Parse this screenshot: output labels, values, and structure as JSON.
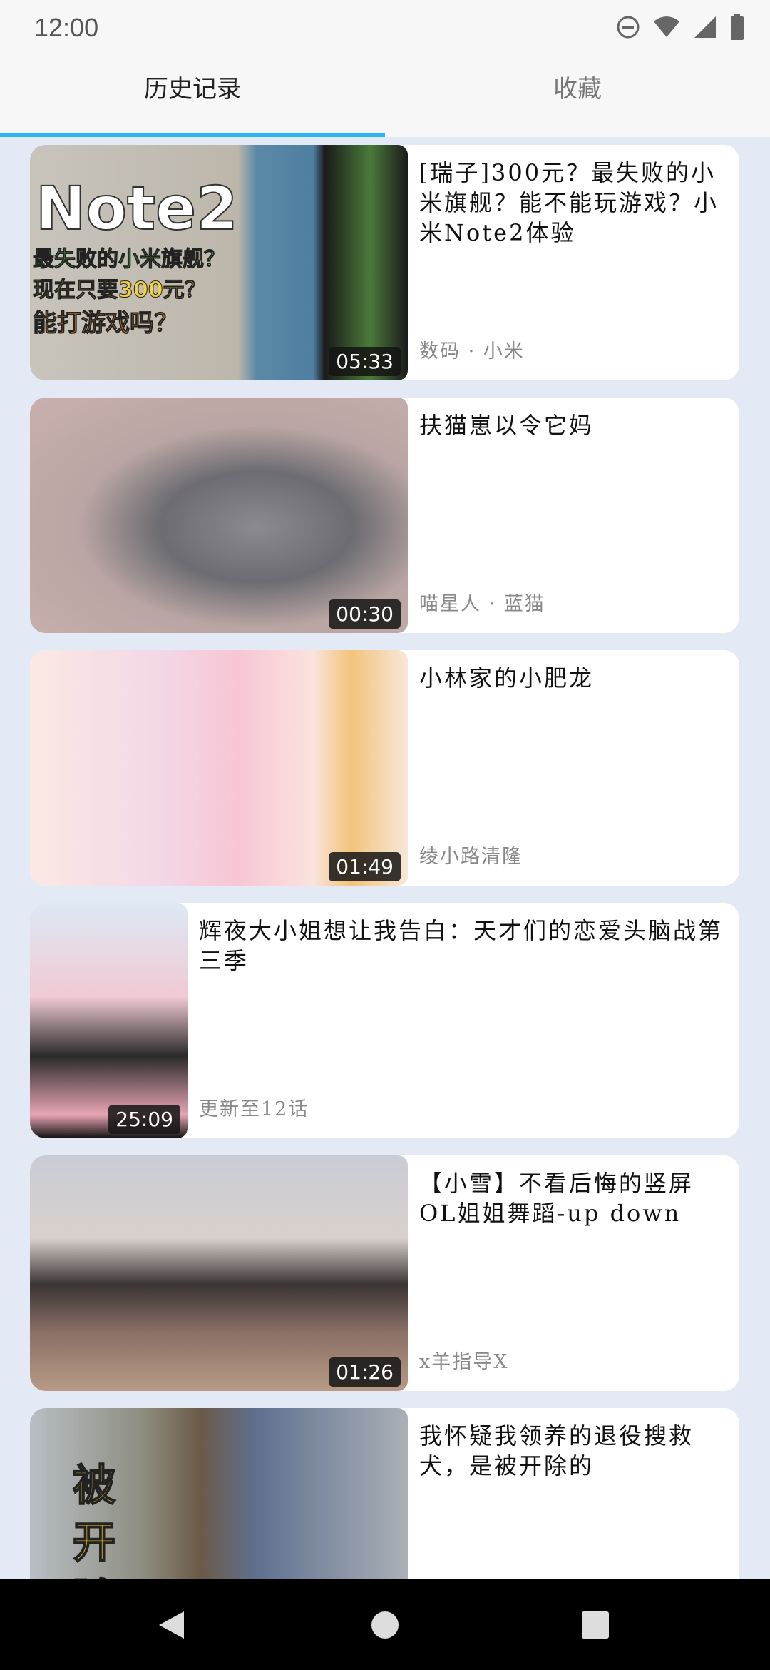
{
  "status_bar": {
    "time": "12:00",
    "icons": [
      "dnd-icon",
      "wifi-icon",
      "signal-icon",
      "battery-icon"
    ]
  },
  "tabs": [
    {
      "label": "历史记录",
      "active": true
    },
    {
      "label": "收藏",
      "active": false
    }
  ],
  "accent_color": "#29b6f6",
  "items": [
    {
      "title": "[瑞子]300元？最失败的小米旗舰？能不能玩游戏？小米Note2体验",
      "meta": "数码 · 小米",
      "duration": "05:33",
      "thumb_text": [
        "Note2",
        "最失败的小米旗舰？",
        "现在只要300元？",
        "能打游戏吗？"
      ]
    },
    {
      "title": "扶猫崽以令它妈",
      "meta": "喵星人 · 蓝猫",
      "duration": "00:30"
    },
    {
      "title": "小林家的小肥龙",
      "meta": "绫小路清隆",
      "duration": "01:49"
    },
    {
      "title": "辉夜大小姐想让我告白：天才们的恋爱头脑战第三季",
      "meta": "更新至12话",
      "duration": "25:09"
    },
    {
      "title": "【小雪】不看后悔的竖屏OL姐姐舞蹈-up down",
      "meta": "x羊指导X",
      "duration": "01:26"
    },
    {
      "title": "我怀疑我领养的退役搜救犬，是被开除的",
      "meta": "",
      "duration": "",
      "thumb_text": [
        "被",
        "开",
        "除"
      ]
    }
  ],
  "nav_bar": {
    "icons": [
      "back-icon",
      "home-icon",
      "recents-icon"
    ]
  }
}
